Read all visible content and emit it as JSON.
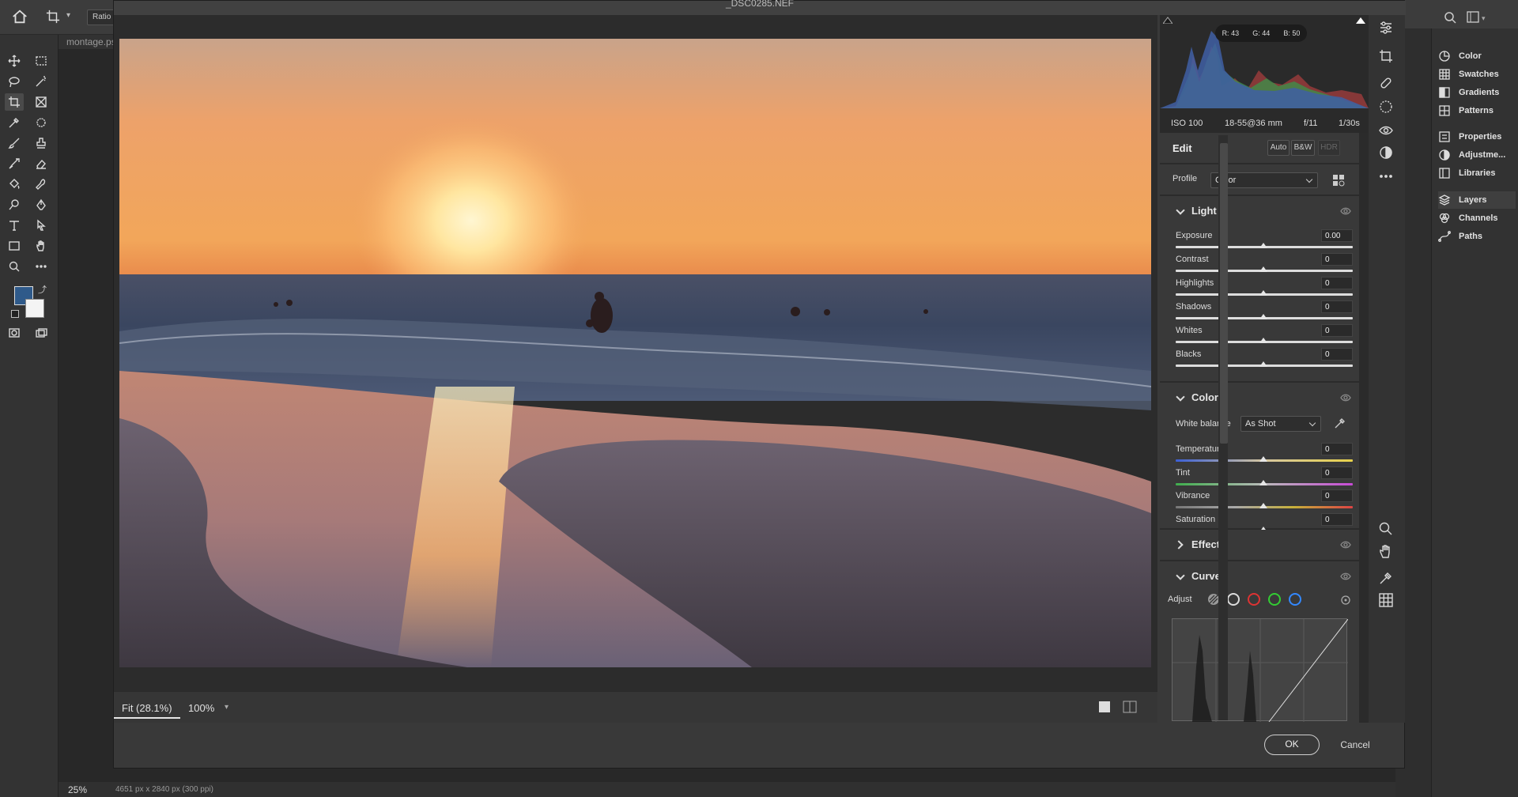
{
  "ps": {
    "options": {
      "ratio_label": "Ratio"
    },
    "doc_tab": "montage.ps",
    "status": {
      "zoom": "25%",
      "doc_info": "4651 px x 2840 px (300 ppi)"
    },
    "right_panel": [
      {
        "label": "Color",
        "icon": "color-wheel-icon"
      },
      {
        "label": "Swatches",
        "icon": "grid-icon"
      },
      {
        "label": "Gradients",
        "icon": "gradient-icon"
      },
      {
        "label": "Patterns",
        "icon": "pattern-icon"
      },
      {
        "label": "Properties",
        "icon": "properties-icon"
      },
      {
        "label": "Adjustme...",
        "icon": "adjustments-icon"
      },
      {
        "label": "Libraries",
        "icon": "libraries-icon"
      },
      {
        "label": "Layers",
        "icon": "layers-icon"
      },
      {
        "label": "Channels",
        "icon": "channels-icon"
      },
      {
        "label": "Paths",
        "icon": "paths-icon"
      }
    ]
  },
  "acr": {
    "title": "_DSC0285.NEF",
    "zoom": {
      "fit": "Fit (28.1%)",
      "pct": "100%"
    },
    "histogram": {
      "r": "R: 43",
      "g": "G: 44",
      "b": "B: 50"
    },
    "exif": {
      "iso": "ISO 100",
      "lens": "18-55@36 mm",
      "aperture": "f/11",
      "shutter": "1/30s"
    },
    "edit": {
      "title": "Edit",
      "auto": "Auto",
      "bw": "B&W",
      "hdr": "HDR",
      "profile_label": "Profile",
      "profile_value": "Color"
    },
    "light": {
      "title": "Light",
      "sliders": [
        {
          "label": "Exposure",
          "value": "0.00"
        },
        {
          "label": "Contrast",
          "value": "0"
        },
        {
          "label": "Highlights",
          "value": "0"
        },
        {
          "label": "Shadows",
          "value": "0"
        },
        {
          "label": "Whites",
          "value": "0"
        },
        {
          "label": "Blacks",
          "value": "0"
        }
      ]
    },
    "color": {
      "title": "Color",
      "wb_label": "White balance",
      "wb_value": "As Shot",
      "sliders": [
        {
          "label": "Temperature",
          "value": "0"
        },
        {
          "label": "Tint",
          "value": "0"
        },
        {
          "label": "Vibrance",
          "value": "0"
        },
        {
          "label": "Saturation",
          "value": "0"
        }
      ]
    },
    "effects": {
      "title": "Effects"
    },
    "curve": {
      "title": "Curve",
      "adjust_label": "Adjust"
    },
    "buttons": {
      "ok": "OK",
      "cancel": "Cancel"
    }
  }
}
